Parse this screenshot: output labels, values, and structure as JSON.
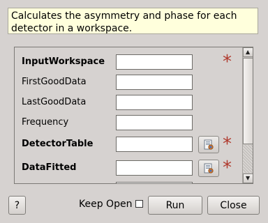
{
  "description": "Calculates the asymmetry and phase for each detector in a workspace.",
  "description_lines": [
    "Calculates the asymmetry and phase for each",
    "detector in a workspace."
  ],
  "properties": [
    {
      "label": "InputWorkspace",
      "value": "",
      "required": true,
      "bold": true,
      "browse": false
    },
    {
      "label": "FirstGoodData",
      "value": "",
      "required": false,
      "bold": false,
      "browse": false
    },
    {
      "label": "LastGoodData",
      "value": "",
      "required": false,
      "bold": false,
      "browse": false
    },
    {
      "label": "Frequency",
      "value": "",
      "required": false,
      "bold": false,
      "browse": false
    },
    {
      "label": "DetectorTable",
      "value": "",
      "required": true,
      "bold": true,
      "browse": true
    },
    {
      "label": "DataFitted",
      "value": "",
      "required": true,
      "bold": true,
      "browse": true
    }
  ],
  "required_marker": "*",
  "footer": {
    "help_label": "?",
    "keep_open_label": "Keep Open",
    "keep_open_checked": false,
    "run_label": "Run",
    "close_label": "Close"
  },
  "colors": {
    "required_star": "#b03a2e",
    "description_bg": "#ffffdc",
    "window_bg": "#d6d2d0"
  }
}
